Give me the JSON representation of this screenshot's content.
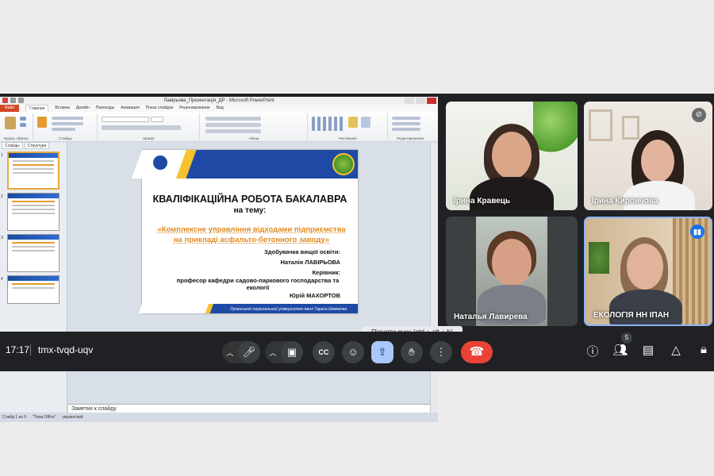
{
  "meeting": {
    "time": "17:17",
    "code": "tmx-tvqd-uqv",
    "participants_count": "5",
    "tooltip": "Підняти руку (ctrl + alt + h)"
  },
  "powerpoint": {
    "window_title": "Лавірьова_Презентація_ДР - Microsoft PowerPoint",
    "file_tab": "Файл",
    "tabs": [
      "Главная",
      "Вставка",
      "Дизайн",
      "Переходы",
      "Анимация",
      "Показ слайдов",
      "Рецензирование",
      "Вид"
    ],
    "ribbon_groups": [
      "Буфер обмена",
      "Слайды",
      "Шрифт",
      "Абзац",
      "Рисование",
      "Редактирование"
    ],
    "pane_tabs": [
      "Слайды",
      "Структура"
    ],
    "notes_placeholder": "Заметки к слайду",
    "status": [
      "Слайд 1 из 9",
      "\"Тема Office\"",
      "украинский"
    ]
  },
  "slide": {
    "title": "КВАЛІФІКАЦІЙНА РОБОТА БАКАЛАВРА",
    "subtitle": "на тему:",
    "topic": "«Комплексне управління відходами підприємства на прикладі асфальто-бетонного заводу»",
    "line1": "Здобувачка вищої освіти:",
    "line2": "Наталія  ЛАВІРЬОВА",
    "line3": "Керівник:",
    "line4": "професор кафедри садово-паркового господарства та екології",
    "line5": "Юрій МАХОРТОВ",
    "university": "Луганський національний університет імені Тараса Шевченка"
  },
  "participants": [
    {
      "name": "Ірина Кравець"
    },
    {
      "name": "Ірина Кирпичова"
    },
    {
      "name": "Наталья Лавирева"
    },
    {
      "name": "ЕКОЛОГІЯ НН ІПАН"
    }
  ]
}
